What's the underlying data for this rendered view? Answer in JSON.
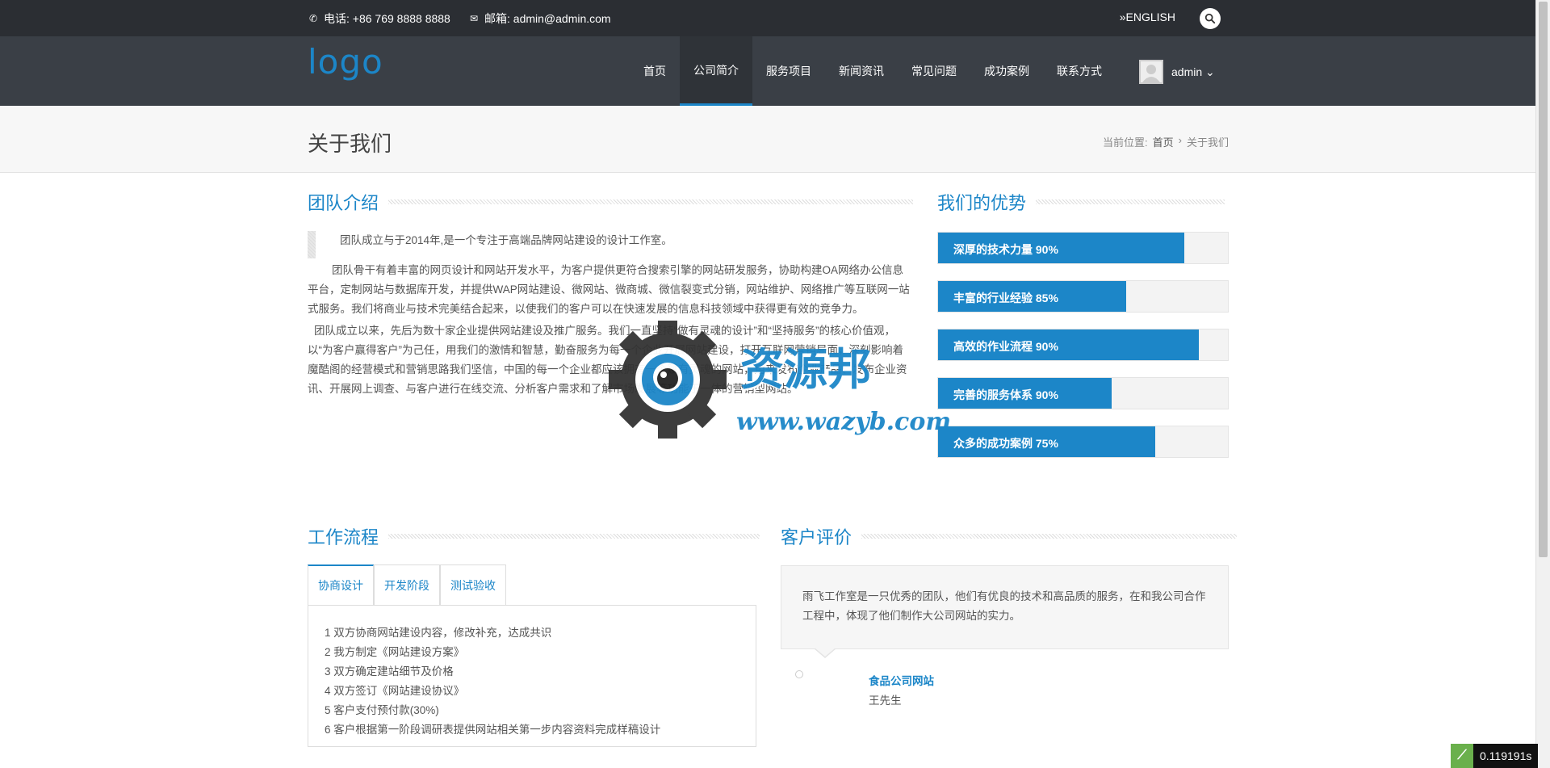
{
  "topbar": {
    "phone": "电话: +86 769 8888 8888",
    "email": "邮箱: admin@admin.com",
    "english": "»ENGLISH"
  },
  "logo": "logo",
  "nav": [
    "首页",
    "公司简介",
    "服务项目",
    "新闻资讯",
    "常见问题",
    "成功案例",
    "联系方式"
  ],
  "nav_active": "公司简介",
  "user": {
    "name": "admin ⌄"
  },
  "page": {
    "title": "关于我们",
    "breadcrumb_prefix": "当前位置:",
    "breadcrumb_home": "首页",
    "breadcrumb_sep": "›",
    "breadcrumb_current": "关于我们"
  },
  "team": {
    "heading": "团队介绍",
    "quote": "团队成立与于2014年,是一个专注于高端品牌网站建设的设计工作室。",
    "p1": "团队骨干有着丰富的网页设计和网站开发水平，为客户提供更符合搜索引擎的网站研发服务，协助构建OA网络办公信息平台，定制网站与数据库开发，并提供WAP网站建设、微网站、微商城、微信裂变式分销，网站维护、网络推广等互联网一站式服务。我们将商业与技术完美结合起来，以使我们的客户可以在快速发展的信息科技领域中获得更有效的竞争力。",
    "p2": "团队成立以来，先后为数十家企业提供网站建设及推广服务。我们一直坚持“做有灵魂的设计”和“坚持服务”的核心价值观，以“为客户赢得客户”为己任，用我们的激情和智慧，勤奋服务为每一个企业开展网站建设，打开互联网营销局面，深刻影响着魔酷阁的经营模式和营销思路我们坚信，中国的每一个企业都应该拥有一个赋有灵魂的网站，用来发布企业产品、发布企业资讯、开展网上调查、与客户进行在线交流、分析客户需求和了解市场发展等功能于一体的营销型网站。"
  },
  "advantages": {
    "heading": "我们的优势",
    "items": [
      {
        "label": "深厚的技术力量 90%",
        "percent": 85
      },
      {
        "label": "丰富的行业经验 85%",
        "percent": 65
      },
      {
        "label": "高效的作业流程 90%",
        "percent": 90
      },
      {
        "label": "完善的服务体系 90%",
        "percent": 60
      },
      {
        "label": "众多的成功案例 75%",
        "percent": 75
      }
    ],
    "fill_color": "#1c86c8"
  },
  "workflow": {
    "heading": "工作流程",
    "tabs": [
      "协商设计",
      "开发阶段",
      "测试验收"
    ],
    "active_tab": "协商设计",
    "steps": [
      "1 双方协商网站建设内容，修改补充，达成共识",
      "2 我方制定《网站建设方案》",
      "3 双方确定建站细节及价格",
      "4 双方签订《网站建设协议》",
      "5 客户支付预付款(30%)",
      "6 客户根据第一阶段调研表提供网站相关第一步内容资料完成样稿设计"
    ]
  },
  "reviews": {
    "heading": "客户评价",
    "text": "雨飞工作室是一只优秀的团队，他们有优良的技术和高品质的服务，在和我公司合作工程中，体现了他们制作大公司网站的实力。",
    "client": "食品公司网站",
    "person": "王先生"
  },
  "watermark": {
    "cn": "资源邦",
    "url": "www.wazyb.com"
  },
  "timer": "0.119191s",
  "colors": {
    "accent": "#1c86c8",
    "topbar": "#2b2e33",
    "navbar": "#3a3f46"
  }
}
